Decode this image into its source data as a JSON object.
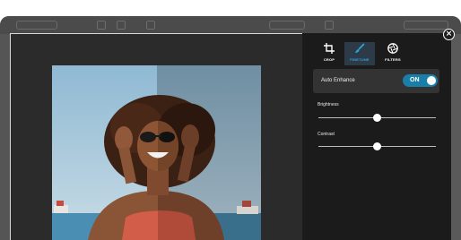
{
  "editor": {
    "close_glyph": "×",
    "tabs": [
      {
        "label": "CROP",
        "icon": "crop-icon",
        "active": false
      },
      {
        "label": "FINETUNE",
        "icon": "brush-icon",
        "active": true
      },
      {
        "label": "FILTERS",
        "icon": "aperture-icon",
        "active": false
      }
    ],
    "auto_enhance": {
      "label": "Auto Enhance",
      "state": "ON"
    },
    "sliders": [
      {
        "label": "Brightness",
        "value_fraction": 0.5
      },
      {
        "label": "Contrast",
        "value_fraction": 0.5
      }
    ]
  },
  "colors": {
    "accent": "#2fa4dd",
    "toggle_on": "#1a7fa8",
    "panel_bg": "#1b1b1b",
    "modal_bg": "#2b2b2b"
  }
}
